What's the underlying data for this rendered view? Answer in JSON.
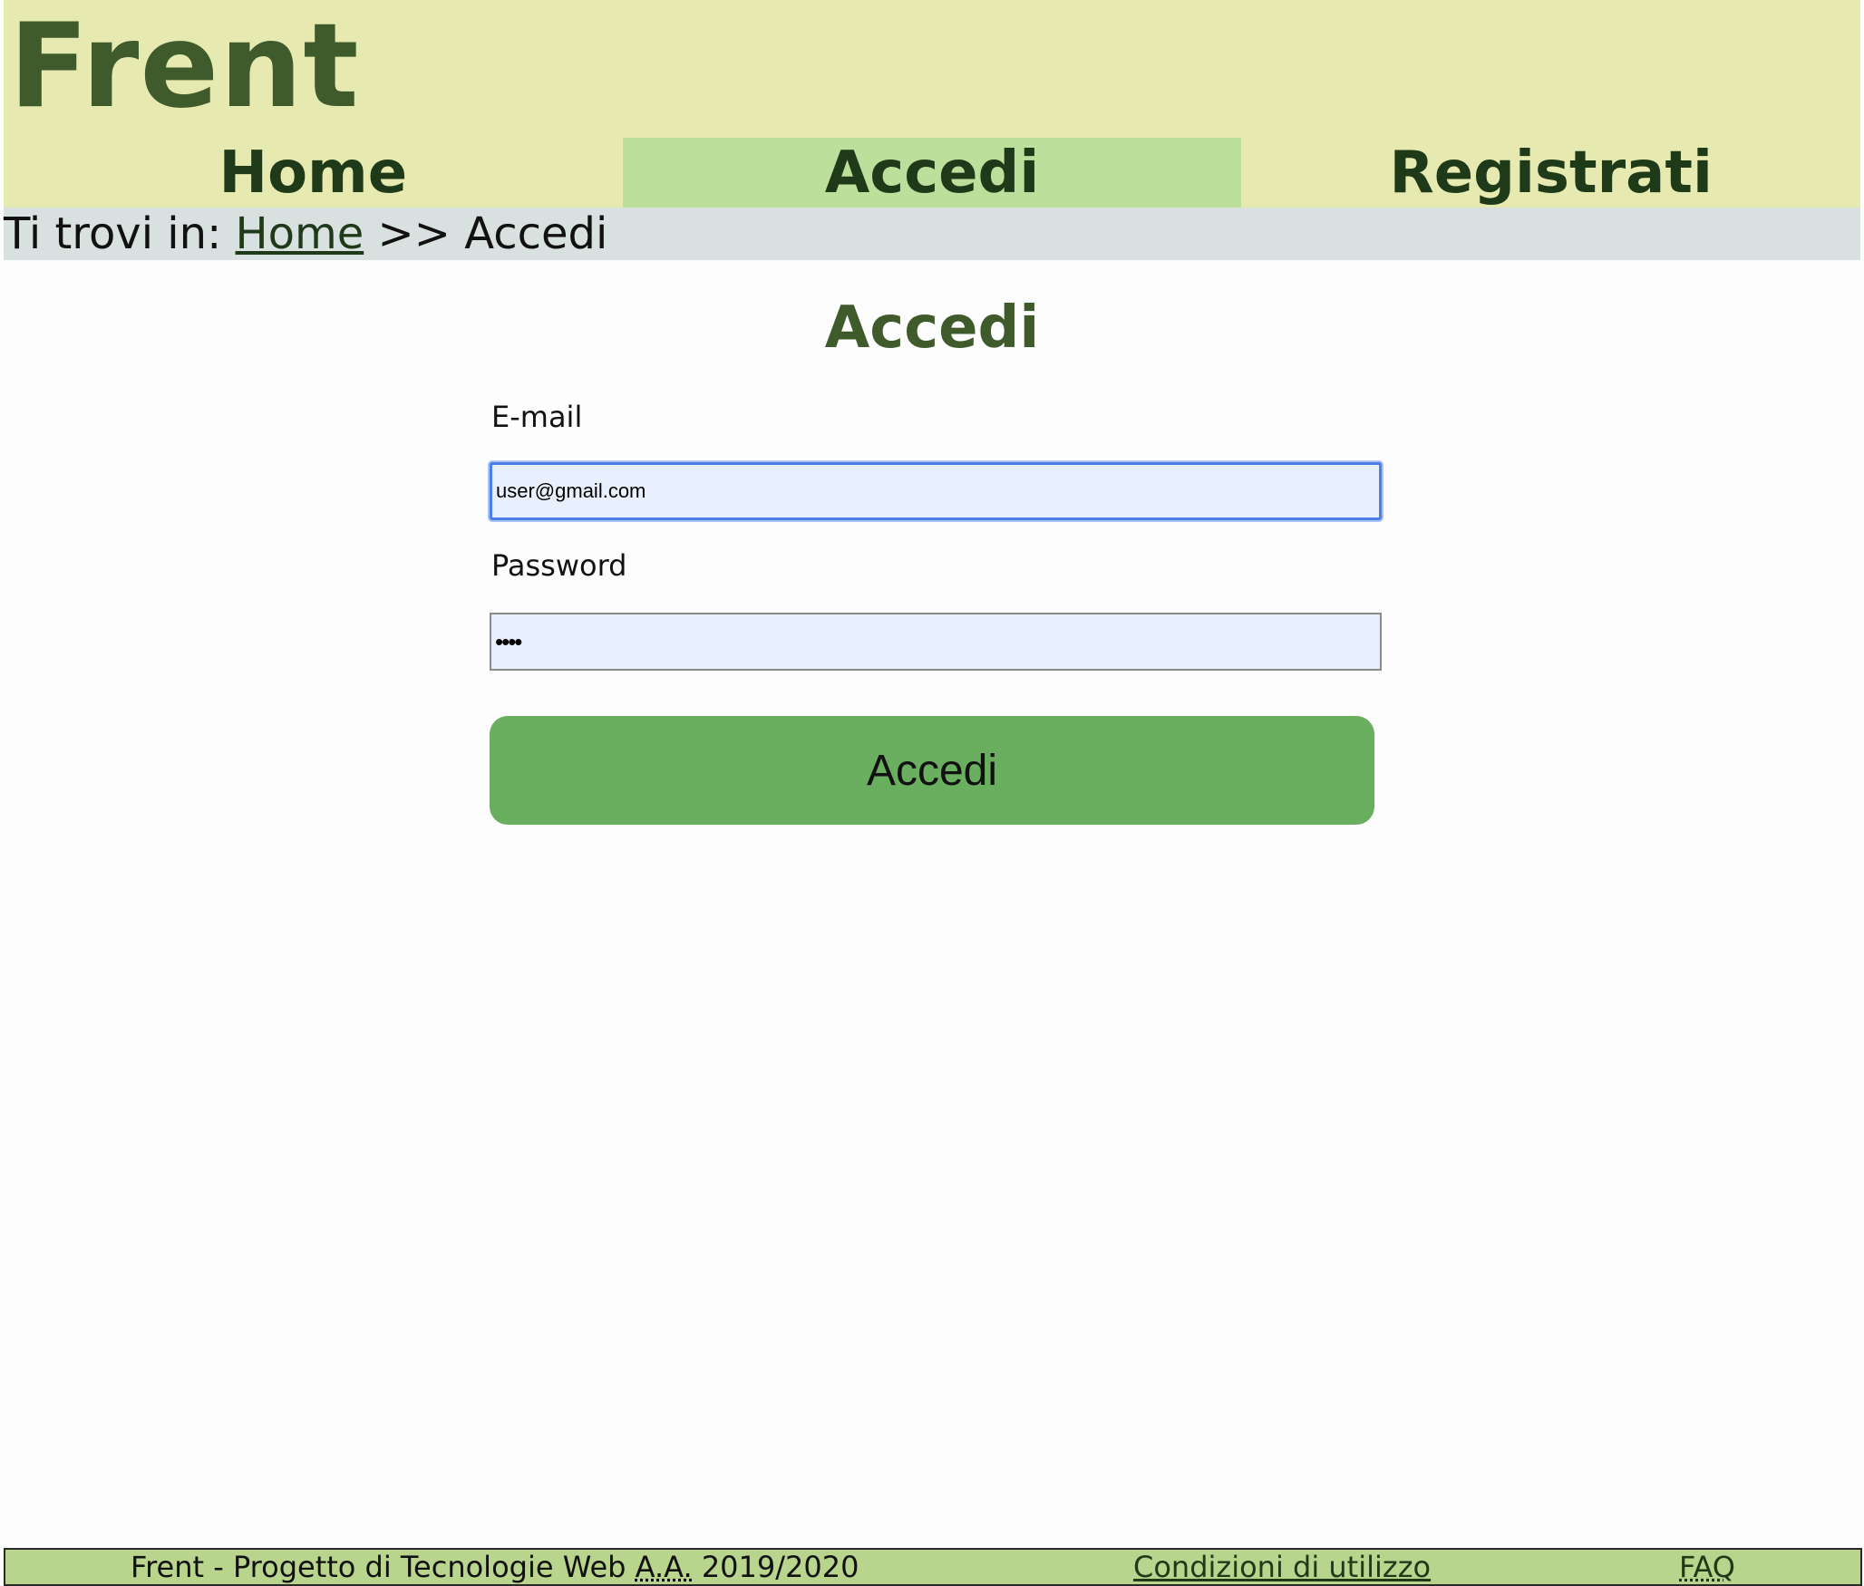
{
  "header": {
    "logo": "Frent",
    "nav": [
      {
        "label": "Home",
        "active": false
      },
      {
        "label": "Accedi",
        "active": true
      },
      {
        "label": "Registrati",
        "active": false
      }
    ]
  },
  "breadcrumb": {
    "prefix": "Ti trovi in:",
    "home_link": "Home",
    "separator": ">>",
    "current": "Accedi"
  },
  "main": {
    "title": "Accedi",
    "email": {
      "label": "E-mail",
      "value": "user@gmail.com"
    },
    "password": {
      "label": "Password",
      "value": "••••"
    },
    "submit_label": "Accedi"
  },
  "footer": {
    "text_before": "Frent - Progetto di Tecnologie Web ",
    "abbr": "A.A.",
    "text_after": " 2019/2020",
    "terms_link": "Condizioni di utilizzo",
    "faq_link": "FAQ"
  },
  "colors": {
    "header_bg": "#e6e9b0",
    "nav_active_bg": "#bcdf9b",
    "brand_text": "#3f5a2b",
    "breadcrumb_bg": "#d8e1e0",
    "button_bg": "#6aae5f",
    "input_bg": "#e8f0fd",
    "footer_bg": "#b8d48d"
  }
}
